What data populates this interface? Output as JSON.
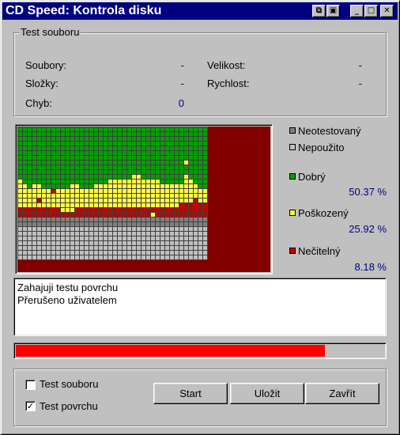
{
  "window": {
    "title": "CD Speed: Kontrola disku"
  },
  "file_test": {
    "legend": "Test souboru",
    "files_label": "Soubory:",
    "files_value": "-",
    "folders_label": "Složky:",
    "folders_value": "-",
    "errors_label": "Chyb:",
    "errors_value": "0",
    "size_label": "Velikost:",
    "size_value": "-",
    "speed_label": "Rychlost:",
    "speed_value": "-"
  },
  "legend": {
    "untested": {
      "label": "Neotestovaný",
      "color": "#808080"
    },
    "unused": {
      "label": "Nepoužito",
      "color": "#c0c0c0"
    },
    "good": {
      "label": "Dobrý",
      "color": "#00a000",
      "pct": "50.37 %"
    },
    "damaged": {
      "label": "Poškozený",
      "color": "#ffff40",
      "pct": "25.92 %"
    },
    "unreadable": {
      "label": "Nečitelný",
      "color": "#c00000",
      "pct": "8.18 %"
    }
  },
  "surface_map": {
    "background_color": "#800000",
    "columns": 40,
    "status_rows": [
      "GGGGGGGGGGGGGGGGGGGGGGGGGGGGGGGGGGGGGGGG",
      "GGGGGGGGGGGGGGGGGGGGGGGGGGGGGGGGGGGGGGGG",
      "GGGGGGGGGGGGGGGGGGGGGGGGGGGGGGGGGGGGGGGG",
      "GGGGGGGGGGGGGGGGGGGGGGGGGGGGGGGGGGGGGGGG",
      "GGGGGGGGGGGGGGGGGGGGGGGGGGGGGGGGGGGGGGGG",
      "GGGGGGGGGGGGGGGGGGGGGGGGGGGGGGGGGGGGGGGG",
      "GGGGGGGGGGGGGGGGGGGGGGGGGGGGGGGGGGGGGGGG",
      "GGGGGGGGGGGGGGGGGGGGGGGGGGGGGGGGGGGYGGGG",
      "GGGGGGGGGGGGGGGGGGGGGGGGGGGGGGGGGGGGGGGG",
      "GGGGGGGGGGGGGGGGGGGGGGGGGGGGGGGGGGGGGGGG",
      "GGGGGGGGGGGGGGGGGGGGGGGGYYGGGGGGGGGYGGGG",
      "YGGGGGGGGGGGGGGGGGGYYYYYYYYYYYGGGGGYYGGG",
      "YYGYYGGGGGGYYGGGYYYYYYYYYYYYYYYYYYYYYYGG",
      "YYYYYYYRYYYYYYYYYYYYYYYYYYYYYYYYYYYYYYYY",
      "YYYYYYYYYYYYYYYYYYYYYYYYYYYYYYYYYYYYYYYY",
      "YYYYRYYYYYYYYYYYYYYYYYYYYYYYYYYYYYYYYRYY",
      "YYYYYYYYYYYYYYYYYYYYYYYYYYYYYYYYYYRRRRRR",
      "RRRRRRRRRYYYRRRRRRRRRRRRRRRRRRRRRRRRRRRR",
      "RRRRRRRRRRRRRRRRRRRRRRRRRRRRYRRRRRRRRRRR",
      "DDDDDDDDDDDDDDDDDDDDDDDDDDDDDDDDDDDDDDDD",
      "DDDDDDDDDDDDDDDDDDDDDDDDDDDDDDDDDDDDDDDD",
      "UUUUUUUUUUUUUUUUUUUUUUUUUUUUUUUUUUUUUUUU",
      "UUUUUUUUUUUUUUUUUUUUUUUUUUUUUUUUUUUUUUUU",
      "UUUUUUUUUUUUUUUUUUUUUUUUUUUUUUUUUUUUUUUU",
      "UUUUUUUUUUUUUUUUUUUUUUUUUUUUUUUUUUUUUUUU",
      "UUUUUUUUUUUUUUUUUUUUUUUUUUUUUUUUUUUUUUUU",
      "UUUUUUUUUUUUUUUUUUUUUUUUUUUUUUUUUUUUUUUU",
      "UUUUUUUUUUUUUUUUUUUUUUUUUUUUUUUUUUUUUUUU"
    ]
  },
  "log": {
    "line1": "Zahajuji testu povrchu",
    "line2": "Přerušeno uživatelem"
  },
  "progress": {
    "fraction": 0.84,
    "color": "#ff0000"
  },
  "options": {
    "file_test_label": "Test souboru",
    "file_test_checked": false,
    "surface_test_label": "Test povrchu",
    "surface_test_checked": true
  },
  "buttons": {
    "start": "Start",
    "save": "Uložit",
    "close": "Zavřít"
  }
}
